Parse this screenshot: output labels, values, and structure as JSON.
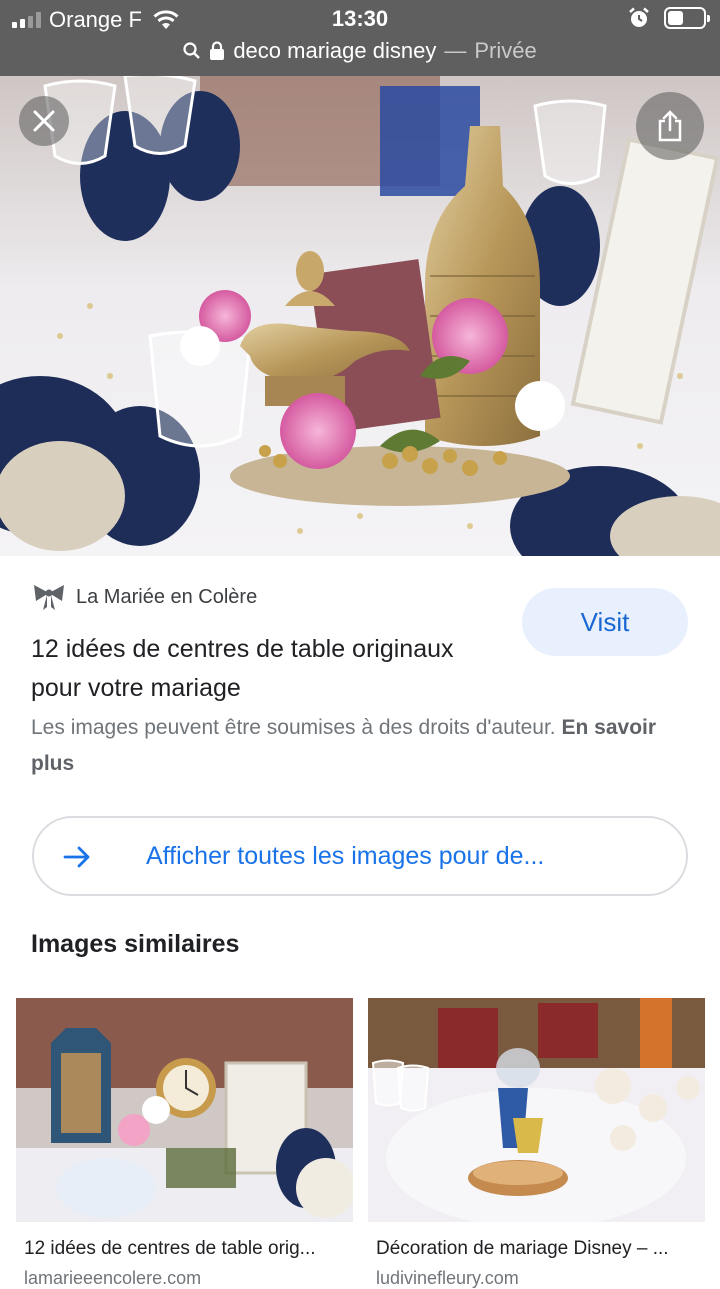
{
  "status": {
    "carrier": "Orange F",
    "time": "13:30"
  },
  "browser": {
    "url_text": "deco mariage disney",
    "separator": "—",
    "mode": "Privée"
  },
  "result": {
    "source_name": "La Mariée en Colère",
    "visit_label": "Visit",
    "title": "12 idées de centres de table originaux pour votre mariage",
    "copyright_text": "Les images peuvent être soumises à des droits d'auteur.",
    "learn_more": "En savoir plus"
  },
  "all_images_label": "Afficher toutes les images pour de...",
  "similar": {
    "heading": "Images similaires",
    "items": [
      {
        "title": "12 idées de centres de table orig...",
        "domain": "lamarieeencolere.com"
      },
      {
        "title": "Décoration de mariage Disney – ...",
        "domain": "ludivinefleury.com"
      }
    ]
  },
  "colors": {
    "accent": "#1a73e8",
    "visit_bg": "#e8f0fe",
    "status_bg": "#5f5f5f"
  }
}
